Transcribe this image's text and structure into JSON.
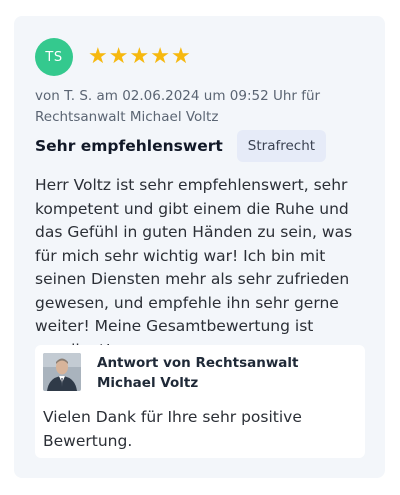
{
  "review": {
    "initials": "TS",
    "rating": 5,
    "stars": [
      "★",
      "★",
      "★",
      "★",
      "★"
    ],
    "meta": "von T. S. am 02.06.2024 um 09:52 Uhr für Rechtsanwalt Michael Voltz",
    "title": "Sehr empfehlenswert",
    "tag": "Strafrecht",
    "text": "Herr Voltz ist sehr empfehlenswert, sehr kompetent und gibt einem die Ruhe und das Gefühl in guten Händen zu sein, was für mich sehr wichtig war! Ich bin mit seinen Diensten mehr als sehr zufrieden gewesen, und empfehle ihn sehr gerne weiter! Meine Gesamtbewertung ist exzellent!"
  },
  "answer": {
    "title": "Antwort von Rechtsanwalt Michael Voltz",
    "text": "Vielen Dank für Ihre sehr positive Bewertung."
  },
  "colors": {
    "avatar": "#34c98e",
    "star": "#f6b80f",
    "card_bg": "#f3f6fa",
    "tag_bg": "#e6ebf8"
  },
  "icons": {
    "star": "star-icon",
    "lawyer_photo": "lawyer-photo"
  }
}
